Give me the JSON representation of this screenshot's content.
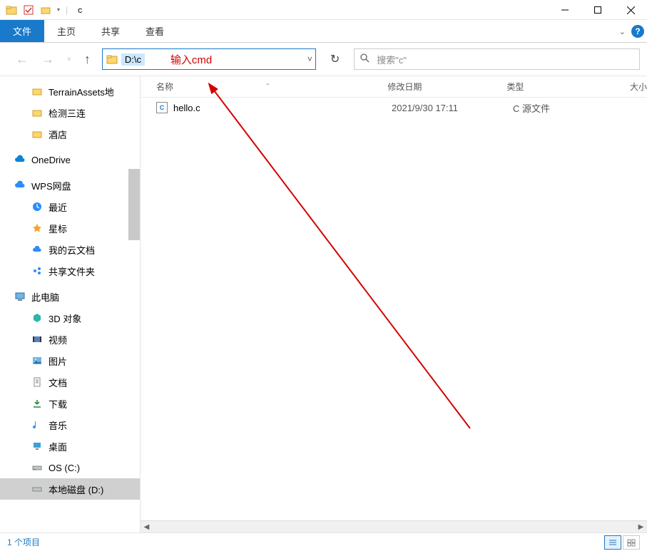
{
  "window": {
    "title": "c"
  },
  "qat": {
    "pin_separator": "|"
  },
  "ribbon": {
    "file": "文件",
    "home": "主页",
    "share": "共享",
    "view": "查看"
  },
  "nav": {
    "address_value": "D:\\c",
    "refresh_tooltip": "刷新"
  },
  "search": {
    "placeholder": "搜索\"c\""
  },
  "annotation": {
    "hint_text": "输入cmd"
  },
  "columns": {
    "name": "名称",
    "date": "修改日期",
    "type": "类型",
    "size": "大小"
  },
  "files": [
    {
      "name": "hello.c",
      "date": "2021/9/30 17:11",
      "type": "C 源文件"
    }
  ],
  "sidebar": {
    "group0": [
      {
        "label": "TerrainAssets地",
        "icon": "folder"
      },
      {
        "label": "检测三连",
        "icon": "folder"
      },
      {
        "label": "酒店",
        "icon": "folder"
      }
    ],
    "onedrive": "OneDrive",
    "wps": "WPS网盘",
    "wps_items": [
      {
        "label": "最近",
        "icon": "clock"
      },
      {
        "label": "星标",
        "icon": "star"
      },
      {
        "label": "我的云文档",
        "icon": "cloud"
      },
      {
        "label": "共享文件夹",
        "icon": "share"
      }
    ],
    "thispc": "此电脑",
    "thispc_items": [
      {
        "label": "3D 对象",
        "icon": "cube"
      },
      {
        "label": "视频",
        "icon": "video"
      },
      {
        "label": "图片",
        "icon": "picture"
      },
      {
        "label": "文档",
        "icon": "document"
      },
      {
        "label": "下载",
        "icon": "download"
      },
      {
        "label": "音乐",
        "icon": "music"
      },
      {
        "label": "桌面",
        "icon": "desktop"
      },
      {
        "label": "OS (C:)",
        "icon": "drive"
      },
      {
        "label": "本地磁盘 (D:)",
        "icon": "drive",
        "selected": true
      }
    ]
  },
  "status": {
    "item_count": "1 个项目"
  }
}
